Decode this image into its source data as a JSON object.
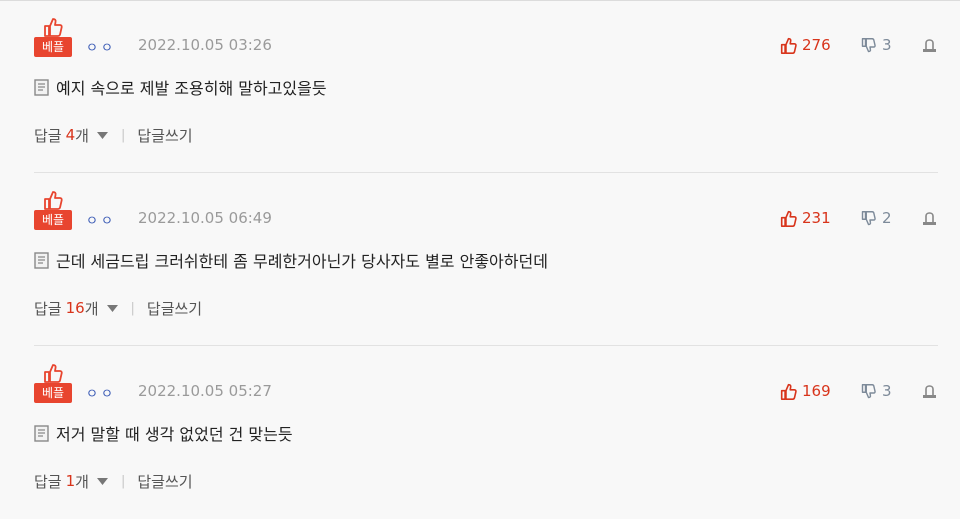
{
  "badge_label": "베플",
  "comments": [
    {
      "nickname": "ㅇㅇ",
      "date": "2022.10.05 03:26",
      "likes": "276",
      "dislikes": "3",
      "content": "예지 속으로 제발 조용히해 말하고있을듯",
      "reply_label": "답글",
      "reply_count": "4",
      "reply_unit": "개",
      "write_reply": "답글쓰기"
    },
    {
      "nickname": "ㅇㅇ",
      "date": "2022.10.05 06:49",
      "likes": "231",
      "dislikes": "2",
      "content": "근데 세금드립 크러쉬한테 좀 무례한거아닌가 당사자도 별로 안좋아하던데",
      "reply_label": "답글",
      "reply_count": "16",
      "reply_unit": "개",
      "write_reply": "답글쓰기"
    },
    {
      "nickname": "ㅇㅇ",
      "date": "2022.10.05 05:27",
      "likes": "169",
      "dislikes": "3",
      "content": "저거 말할 때 생각 없었던 건 맞는듯",
      "reply_label": "답글",
      "reply_count": "1",
      "reply_unit": "개",
      "write_reply": "답글쓰기"
    }
  ],
  "icons": {
    "badge": "thumbs-up-icon",
    "like": "thumbs-up-icon",
    "dislike": "thumbs-down-icon",
    "report": "report-icon",
    "content": "document-icon",
    "caret": "caret-down-icon"
  },
  "colors": {
    "accent_red": "#e8452f",
    "like_red": "#d8341b",
    "nickname_blue": "#3b5bb5",
    "muted_gray": "#9a9a9a",
    "background": "#f8f8f8"
  }
}
